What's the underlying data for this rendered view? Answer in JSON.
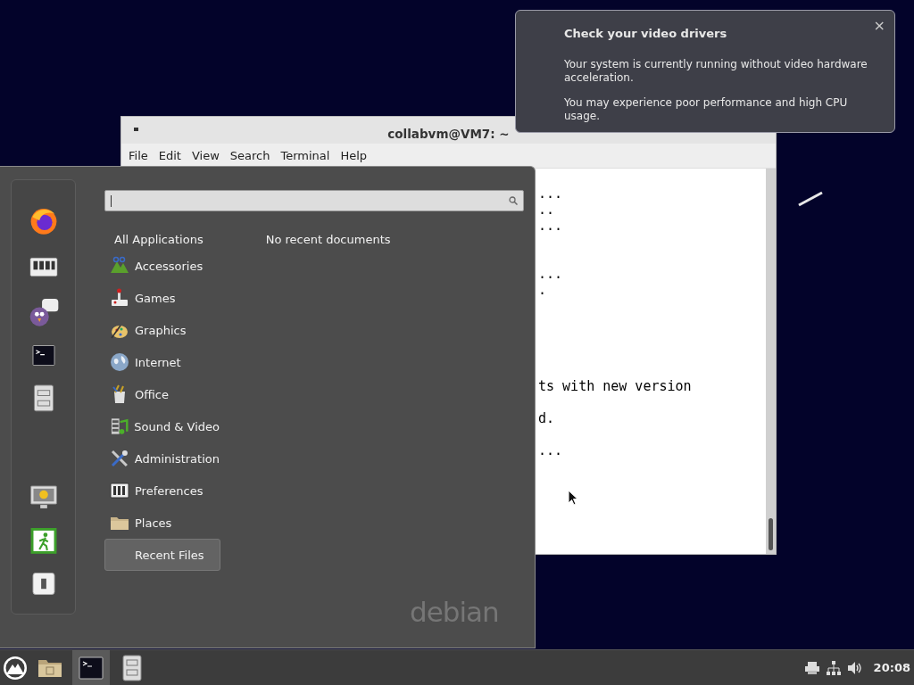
{
  "notification": {
    "title": "Check your video drivers",
    "paragraphs": [
      "Your system is currently running without video hardware acceleration.",
      "You may experience poor performance and high CPU usage."
    ],
    "close": "×"
  },
  "terminal": {
    "title": "collabvm@VM7: ~",
    "menu": [
      "File",
      "Edit",
      "View",
      "Search",
      "Terminal",
      "Help"
    ],
    "lines": [
      {
        "kind": "hidden"
      },
      {
        "kind": "text",
        "text": "..."
      },
      {
        "kind": "text",
        "text": ".."
      },
      {
        "kind": "text",
        "text": "..."
      },
      {
        "kind": "hidden"
      },
      {
        "kind": "hidden"
      },
      {
        "kind": "text",
        "text": "..."
      },
      {
        "kind": "text",
        "text": "."
      },
      {
        "kind": "hidden"
      },
      {
        "kind": "hidden"
      },
      {
        "kind": "hidden"
      },
      {
        "kind": "hidden"
      },
      {
        "kind": "hidden"
      },
      {
        "kind": "text",
        "text": "ts with new version"
      },
      {
        "kind": "hidden"
      },
      {
        "kind": "text",
        "text": "d."
      },
      {
        "kind": "hidden"
      },
      {
        "kind": "text",
        "text": "..."
      }
    ]
  },
  "app_menu": {
    "all_applications": "All Applications",
    "recent_placeholder": "No recent documents",
    "logo_text": "debian",
    "categories": [
      {
        "label": "Accessories",
        "selected": false
      },
      {
        "label": "Games",
        "selected": false
      },
      {
        "label": "Graphics",
        "selected": false
      },
      {
        "label": "Internet",
        "selected": false
      },
      {
        "label": "Office",
        "selected": false
      },
      {
        "label": "Sound & Video",
        "selected": false
      },
      {
        "label": "Administration",
        "selected": false
      },
      {
        "label": "Preferences",
        "selected": false
      },
      {
        "label": "Places",
        "selected": false
      },
      {
        "label": "Recent Files",
        "selected": true
      }
    ]
  },
  "taskbar": {
    "launchers": [
      {
        "active": false
      },
      {
        "active": true
      },
      {
        "active": false
      }
    ],
    "clock": "20:08"
  }
}
